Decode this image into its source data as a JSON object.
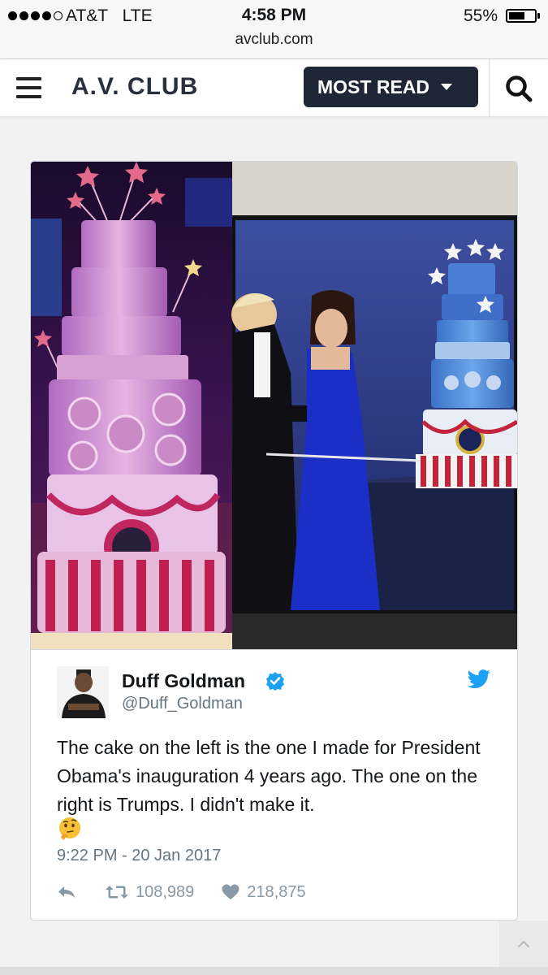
{
  "status_bar": {
    "carrier": "AT&T",
    "network": "LTE",
    "time": "4:58 PM",
    "battery": "55%",
    "url": "avclub.com"
  },
  "header": {
    "logo": "A.V. CLUB",
    "most_read_label": "MOST READ",
    "icons": [
      "hamburger-menu-icon",
      "chevron-down-icon",
      "search-icon"
    ]
  },
  "tweet": {
    "author_name": "Duff Goldman",
    "author_handle": "@Duff_Goldman",
    "text": "The cake on the left is the one I made for President Obama's inauguration 4 years ago. The one on the right is Trumps. I didn't make it.",
    "emoji": "thinking-face",
    "timestamp": "9:22 PM - 20 Jan 2017",
    "retweets": "108,989",
    "likes": "218,875",
    "icons": [
      "verified-badge-icon",
      "twitter-bird-icon",
      "reply-icon",
      "retweet-icon",
      "heart-icon"
    ]
  },
  "colors": {
    "header_button_bg": "#1f2636",
    "twitter_blue": "#1da1f2",
    "muted_text": "#66757f",
    "action_grey": "#8899a6"
  }
}
